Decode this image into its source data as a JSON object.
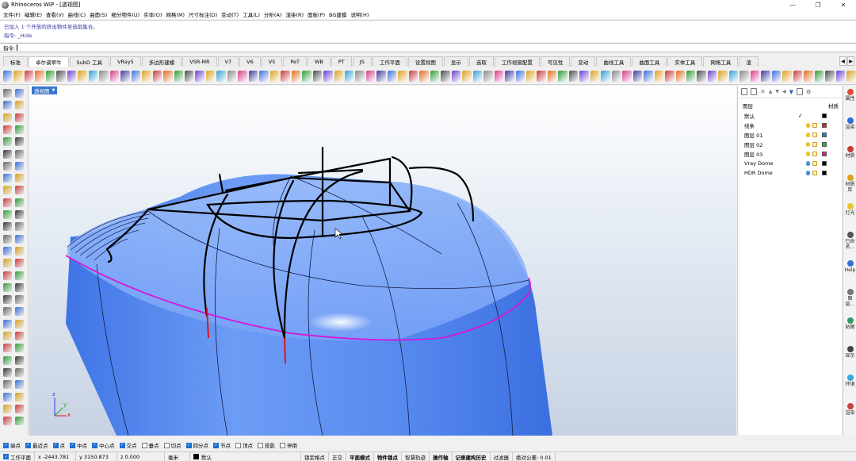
{
  "window": {
    "title": "Rhinoceros WIP - [透视图]",
    "controls": [
      "—",
      "❐",
      "✕"
    ]
  },
  "menu": [
    "文件(F)",
    "编辑(E)",
    "查看(V)",
    "曲线(C)",
    "曲面(S)",
    "细分物件(U)",
    "实体(O)",
    "网格(M)",
    "尺寸标注(D)",
    "变动(T)",
    "工具(L)",
    "分析(A)",
    "渲染(R)",
    "面板(P)",
    "BG建模",
    "说明(H)"
  ],
  "command_history": [
    "已加入 1 个开放的挤出物件至选取集合。",
    "指令: _Hide"
  ],
  "command_prompt": "指令:",
  "tabs": [
    "标准",
    "卓尔谟翠牛",
    "SubD 工具",
    "VRay5",
    "多边形建模",
    "VSR-MR",
    "V7",
    "V6",
    "V5",
    "PeT",
    "WB",
    "PT",
    "JS",
    "工作平面",
    "设置视图",
    "显示",
    "选取",
    "工作视窗配置",
    "可见性",
    "变动",
    "曲线工具",
    "曲面工具",
    "实体工具",
    "网格工具",
    "渲"
  ],
  "active_tab_index": 1,
  "viewport": {
    "label": "透视图",
    "axes": {
      "x": "x",
      "y": "y",
      "z": "z"
    }
  },
  "layers_panel": {
    "header_left": "图层",
    "header_right": "材质",
    "rows": [
      {
        "name": "默认",
        "current": true,
        "color": "#000000",
        "bulb": "yellow"
      },
      {
        "name": "线条",
        "current": false,
        "color": "#e02020",
        "bulb": "yellow"
      },
      {
        "name": "图层 01",
        "current": false,
        "color": "#1f7fe0",
        "bulb": "yellow"
      },
      {
        "name": "图层 02",
        "current": false,
        "color": "#22b832",
        "bulb": "yellow"
      },
      {
        "name": "图层 03",
        "current": false,
        "color": "#e0207f",
        "bulb": "yellow"
      },
      {
        "name": "Vray Dome",
        "current": false,
        "color": "#000000",
        "bulb": "blue"
      },
      {
        "name": "HDR Dome",
        "current": false,
        "color": "#000000",
        "bulb": "blue"
      }
    ],
    "current_mark": "✓"
  },
  "side_tabs": [
    "属性",
    "渲染",
    "材质",
    "材质库",
    "灯光",
    "已命名...",
    "Help",
    "图层...",
    "贴图",
    "显示",
    "环境",
    "渲染"
  ],
  "osnap": [
    {
      "label": "端点",
      "on": true
    },
    {
      "label": "最近点",
      "on": true
    },
    {
      "label": "点",
      "on": true
    },
    {
      "label": "中点",
      "on": true
    },
    {
      "label": "中心点",
      "on": true
    },
    {
      "label": "交点",
      "on": true
    },
    {
      "label": "垂点",
      "on": false
    },
    {
      "label": "切点",
      "on": false
    },
    {
      "label": "四分点",
      "on": true
    },
    {
      "label": "节点",
      "on": true
    },
    {
      "label": "顶点",
      "on": false
    },
    {
      "label": "投影",
      "on": false
    },
    {
      "label": "停用",
      "on": false
    }
  ],
  "status": {
    "cplane": "工作平面",
    "x": "x -2443.781",
    "y": "y 3150.873",
    "z": "z 0.000",
    "unit": "毫米",
    "layer": "默认",
    "toggles": [
      "锁定格点",
      "正交",
      "平面模式",
      "物件锁点",
      "智慧轨迹",
      "操作轴",
      "记录建构历史",
      "过滤器"
    ],
    "bold_toggles": [
      "平面模式",
      "物件锁点",
      "操作轴",
      "记录建构历史"
    ],
    "tolerance": "绝对公差: 0.01"
  },
  "colors": {
    "accent": "#3a74cc",
    "model_blue": "#5b8ef0",
    "edge_magenta": "#d616d6",
    "curve_red": "#e01515"
  }
}
